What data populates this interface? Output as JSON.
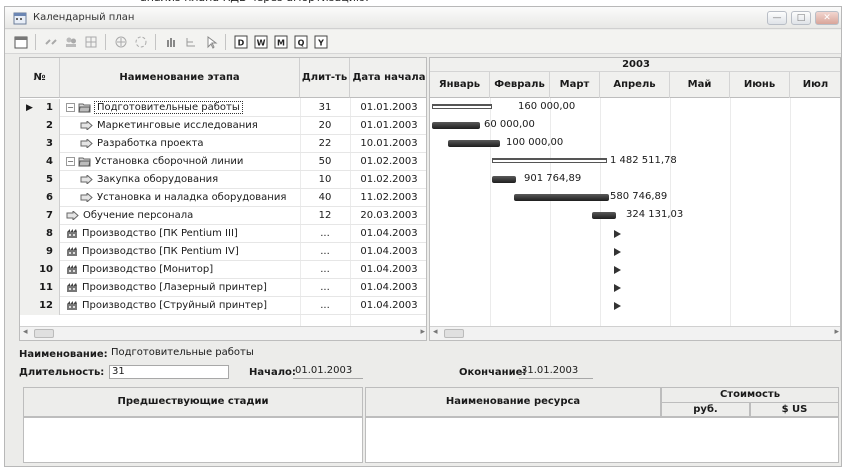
{
  "window": {
    "title": "Календарный план"
  },
  "grid": {
    "columns": {
      "num": "№",
      "name": "Наименование этапа",
      "duration": "Длит-ть",
      "start": "Дата начала"
    },
    "rows": [
      {
        "n": "1",
        "name": "Подготовительные работы",
        "duration": "31",
        "start": "01.01.2003"
      },
      {
        "n": "2",
        "name": "Маркетинговые исследования",
        "duration": "20",
        "start": "01.01.2003"
      },
      {
        "n": "3",
        "name": "Разработка проекта",
        "duration": "22",
        "start": "10.01.2003"
      },
      {
        "n": "4",
        "name": "Установка сборочной линии",
        "duration": "50",
        "start": "01.02.2003"
      },
      {
        "n": "5",
        "name": "Закупка оборудования",
        "duration": "10",
        "start": "01.02.2003"
      },
      {
        "n": "6",
        "name": "Установка и наладка оборудования",
        "duration": "40",
        "start": "11.02.2003"
      },
      {
        "n": "7",
        "name": "Обучение персонала",
        "duration": "12",
        "start": "20.03.2003"
      },
      {
        "n": "8",
        "name": "Производство [ПК Pentium III]",
        "duration": "...",
        "start": "01.04.2003"
      },
      {
        "n": "9",
        "name": "Производство [ПК Pentium IV]",
        "duration": "...",
        "start": "01.04.2003"
      },
      {
        "n": "10",
        "name": "Производство [Монитор]",
        "duration": "...",
        "start": "01.04.2003"
      },
      {
        "n": "11",
        "name": "Производство [Лазерный принтер]",
        "duration": "...",
        "start": "01.04.2003"
      },
      {
        "n": "12",
        "name": "Производство [Струйный принтер]",
        "duration": "...",
        "start": "01.04.2003"
      }
    ]
  },
  "gantt": {
    "year": "2003",
    "months": [
      "Январь",
      "Февраль",
      "Март",
      "Апрель",
      "Май",
      "Июнь",
      "Июл"
    ],
    "bars": [
      {
        "label": "160 000,00"
      },
      {
        "label": "60 000,00"
      },
      {
        "label": "100 000,00"
      },
      {
        "label": "1 482 511,78"
      },
      {
        "label": "901 764,89"
      },
      {
        "label": "580 746,89"
      },
      {
        "label": "324 131,03"
      }
    ]
  },
  "details": {
    "name_label": "Наименование:",
    "name_value": "Подготовительные работы",
    "duration_label": "Длительность:",
    "duration_value": "31",
    "start_label": "Начало:",
    "start_value": "01.01.2003",
    "end_label": "Окончание:",
    "end_value": "31.01.2003",
    "prev_stages": "Предшествующие стадии",
    "resource_name": "Наименование ресурса",
    "cost": "Стоимость",
    "rub": "руб.",
    "usd": "$ US"
  }
}
